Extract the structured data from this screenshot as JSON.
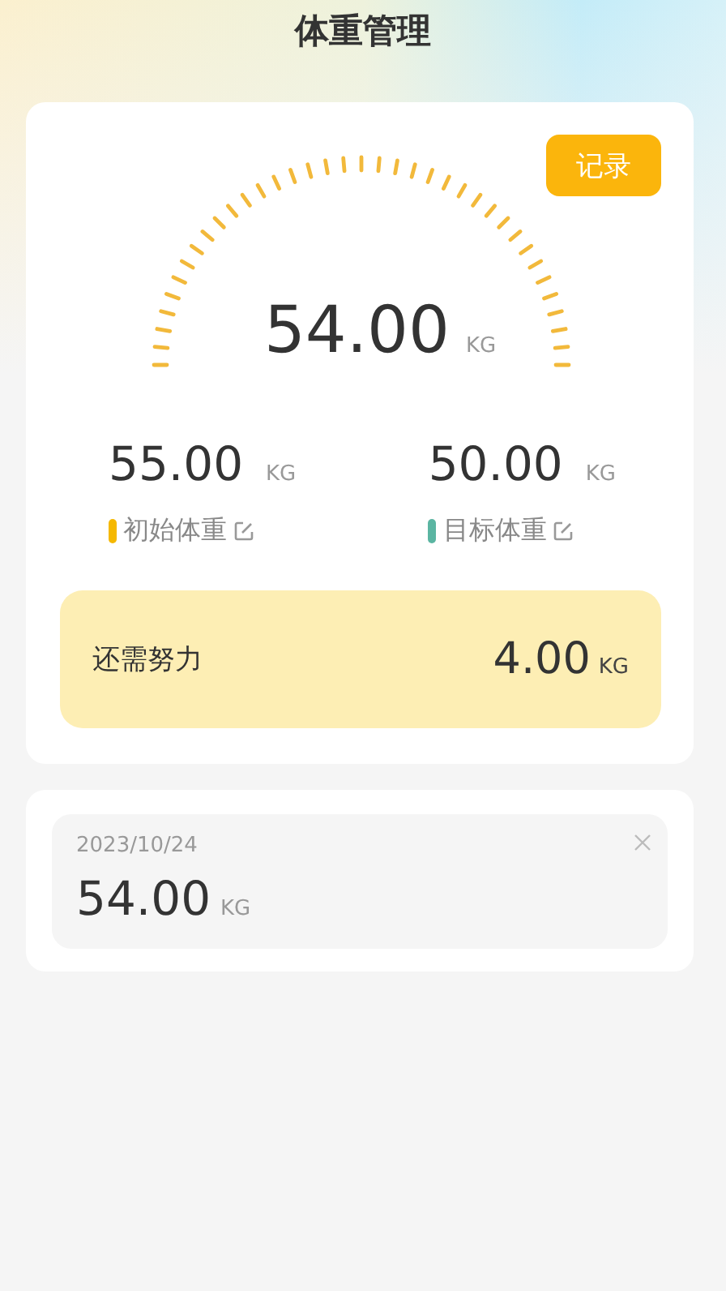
{
  "title": "体重管理",
  "record_button": "记录",
  "current": {
    "value": "54.00",
    "unit": "KG"
  },
  "stats": [
    {
      "value": "55.00",
      "unit": "KG",
      "label": "初始体重",
      "color": "#f5b800"
    },
    {
      "value": "50.00",
      "unit": "KG",
      "label": "目标体重",
      "color": "#5bb5a2"
    }
  ],
  "remaining": {
    "label": "还需努力",
    "value": "4.00",
    "unit": "KG"
  },
  "records": [
    {
      "date": "2023/10/24",
      "value": "54.00",
      "unit": "KG"
    }
  ]
}
